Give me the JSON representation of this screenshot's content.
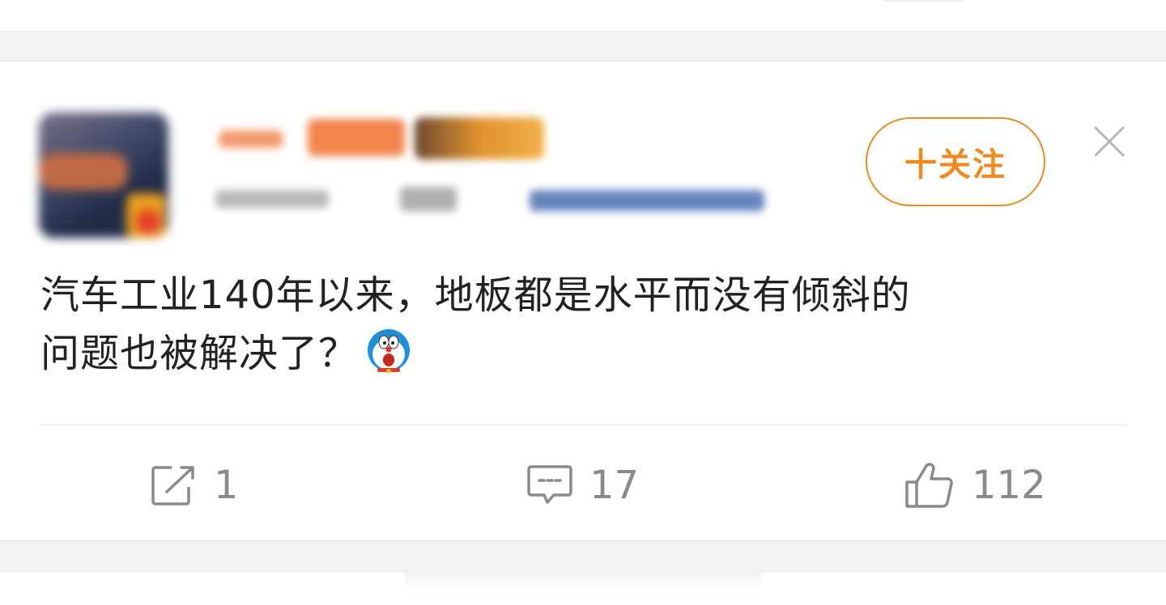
{
  "post": {
    "user_name": "",
    "user_meta": "",
    "follow_label": "十关注",
    "text_line1": "汽车工业140年以来，地板都是水平而没有倾斜的",
    "text_line2": "问题也被解决了？",
    "emoji": "doraemon-face-icon"
  },
  "actions": {
    "repost_count": "1",
    "comment_count": "17",
    "like_count": "112"
  },
  "colors": {
    "accent": "#f08a1d",
    "text": "#222222",
    "muted": "#8a8a8a",
    "separator": "#f2f2f2"
  }
}
